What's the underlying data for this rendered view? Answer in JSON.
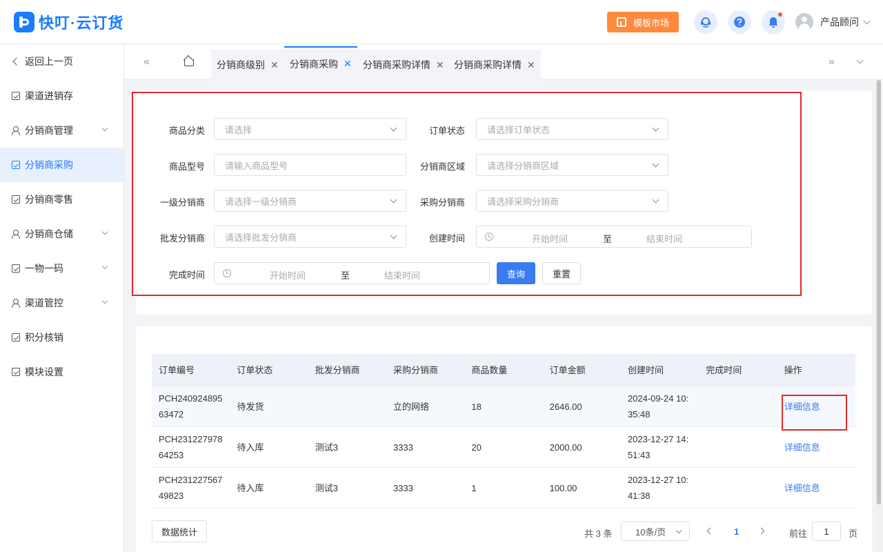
{
  "app": {
    "logo_text": "快叮·云订货"
  },
  "header": {
    "market_label": "模板市场",
    "user_name": "产品顾问"
  },
  "sidebar": {
    "back_label": "返回上一页",
    "items": [
      {
        "label": "渠道进销存"
      },
      {
        "label": "分销商管理"
      },
      {
        "label": "分销商采购"
      },
      {
        "label": "分销商零售"
      },
      {
        "label": "分销商仓储"
      },
      {
        "label": "一物一码"
      },
      {
        "label": "渠道管控"
      },
      {
        "label": "积分核销"
      },
      {
        "label": "模块设置"
      }
    ]
  },
  "tabs": [
    {
      "label": "分销商级别"
    },
    {
      "label": "分销商采购"
    },
    {
      "label": "分销商采购详情"
    },
    {
      "label": "分销商采购详情"
    }
  ],
  "filters": {
    "product_category": {
      "label": "商品分类",
      "placeholder": "请选择"
    },
    "order_status": {
      "label": "订单状态",
      "placeholder": "请选择订单状态"
    },
    "product_model": {
      "label": "商品型号",
      "placeholder": "请输入商品型号"
    },
    "distributor_region": {
      "label": "分销商区域",
      "placeholder": "请选择分销商区域"
    },
    "level1_distributor": {
      "label": "一级分销商",
      "placeholder": "请选择一级分销商"
    },
    "purchase_distributor": {
      "label": "采购分销商",
      "placeholder": "请选择采购分销商"
    },
    "wholesale_distributor": {
      "label": "批发分销商",
      "placeholder": "请选择批发分销商"
    },
    "create_time": {
      "label": "创建时间",
      "start": "开始时间",
      "to": "至",
      "end": "结束时间"
    },
    "complete_time": {
      "label": "完成时间",
      "start": "开始时间",
      "to": "至",
      "end": "结束时间"
    },
    "query_label": "查询",
    "reset_label": "重置"
  },
  "table": {
    "columns": [
      "订单编号",
      "订单状态",
      "批发分销商",
      "采购分销商",
      "商品数量",
      "订单金额",
      "创建时间",
      "完成时间",
      "操作"
    ],
    "rows": [
      {
        "order_no": "PCH24092489563472",
        "status": "待发货",
        "wholesale": "",
        "purchase": "立的网络",
        "qty": "18",
        "amount": "2646.00",
        "created": "2024-09-24 10:35:48",
        "completed": "",
        "action": "详细信息"
      },
      {
        "order_no": "PCH23122797864253",
        "status": "待入库",
        "wholesale": "测试3",
        "purchase": "3333",
        "qty": "20",
        "amount": "2000.00",
        "created": "2023-12-27 14:51:43",
        "completed": "",
        "action": "详细信息"
      },
      {
        "order_no": "PCH23122756749823",
        "status": "待入库",
        "wholesale": "测试3",
        "purchase": "3333",
        "qty": "1",
        "amount": "100.00",
        "created": "2023-12-27 10:41:38",
        "completed": "",
        "action": "详细信息"
      }
    ]
  },
  "footer": {
    "stats_label": "数据统计",
    "total_text": "共 3 条",
    "page_size": "10条/页",
    "current_page": "1",
    "goto_prefix": "前往",
    "goto_value": "1",
    "goto_suffix": "页"
  }
}
